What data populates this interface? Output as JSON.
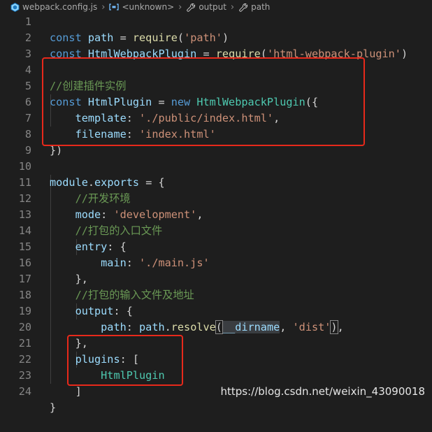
{
  "breadcrumb": {
    "file": "webpack.config.js",
    "symbol": "<unknown>",
    "prop1": "output",
    "prop2": "path"
  },
  "lines": [
    {
      "n": "1"
    },
    {
      "n": "2"
    },
    {
      "n": "3"
    },
    {
      "n": "4"
    },
    {
      "n": "5"
    },
    {
      "n": "6"
    },
    {
      "n": "7"
    },
    {
      "n": "8"
    },
    {
      "n": "9"
    },
    {
      "n": "10"
    },
    {
      "n": "11"
    },
    {
      "n": "12"
    },
    {
      "n": "13"
    },
    {
      "n": "14"
    },
    {
      "n": "15"
    },
    {
      "n": "16"
    },
    {
      "n": "17"
    },
    {
      "n": "18"
    },
    {
      "n": "19"
    },
    {
      "n": "20"
    },
    {
      "n": "21"
    },
    {
      "n": "22"
    },
    {
      "n": "23"
    },
    {
      "n": "24"
    }
  ],
  "code": {
    "l1": {
      "kw": "const",
      "var": "path",
      "eq": " = ",
      "fn": "require",
      "open": "(",
      "str": "'path'",
      "close": ")"
    },
    "l2": {
      "kw": "const",
      "var": "HtmlWebpackPlugin",
      "eq": " = ",
      "fn": "require",
      "open": "(",
      "str": "'html-webpack-plugin'",
      "close": ")"
    },
    "l4": {
      "comment": "//创建插件实例"
    },
    "l5": {
      "kw": "const",
      "var": "HtmlPlugin",
      "eq": " = ",
      "new": "new",
      "cls": "HtmlWebpackPlugin",
      "open": "({"
    },
    "l6": {
      "key": "template",
      "colon": ": ",
      "str": "'./public/index.html'",
      "comma": ","
    },
    "l7": {
      "key": "filename",
      "colon": ": ",
      "str": "'index.html'"
    },
    "l8": {
      "close": "})"
    },
    "l10": {
      "var1": "module",
      "dot": ".",
      "var2": "exports",
      "rest": " = {"
    },
    "l11": {
      "comment": "//开发环境"
    },
    "l12": {
      "key": "mode",
      "colon": ": ",
      "str": "'development'",
      "comma": ","
    },
    "l13": {
      "comment": "//打包的入口文件"
    },
    "l14": {
      "key": "entry",
      "rest": ": {"
    },
    "l15": {
      "key": "main",
      "colon": ": ",
      "str": "'./main.js'"
    },
    "l16": {
      "close": "},"
    },
    "l17": {
      "comment": "//打包的输入文件及地址"
    },
    "l18": {
      "key": "output",
      "rest": ": {"
    },
    "l19": {
      "key": "path",
      "colon": ": ",
      "var": "path",
      "dot": ".",
      "fn": "resolve",
      "open": "(",
      "dirname": "__dirname",
      "sep": ", ",
      "str": "'dist'",
      "close": ")",
      "comma": ","
    },
    "l20": {
      "close": "},"
    },
    "l21": {
      "key": "plugins",
      "rest": ": ["
    },
    "l22": {
      "cls": "HtmlPlugin"
    },
    "l23": {
      "close": "]"
    },
    "l24": {
      "close": "}"
    }
  },
  "watermark": "https://blog.csdn.net/weixin_43090018",
  "colors": {
    "background": "#1e1e1e",
    "keyword": "#569cd6",
    "function": "#dcdcaa",
    "variable": "#9cdcfe",
    "class": "#4ec9b0",
    "string": "#ce9178",
    "comment": "#6a9955",
    "highlight_box": "#e8291b"
  }
}
